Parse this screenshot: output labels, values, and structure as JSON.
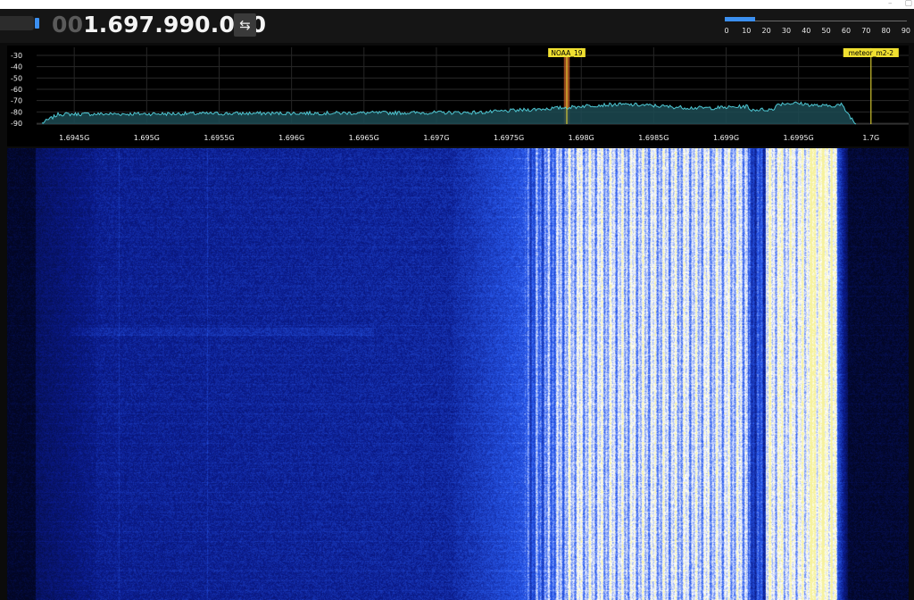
{
  "window": {
    "controls": [
      {
        "name": "minimize-button",
        "glyph": "–"
      },
      {
        "name": "maximize-button",
        "glyph": "▢"
      }
    ]
  },
  "toolbar": {
    "frequency_leading": "00",
    "frequency_main": "1.697.990.000",
    "swap_icon": "⇆"
  },
  "volume": {
    "ticks": [
      "0",
      "10",
      "20",
      "30",
      "40",
      "50",
      "60",
      "70",
      "80",
      "90"
    ],
    "tick_values": [
      0,
      10,
      20,
      30,
      40,
      50,
      60,
      70,
      80,
      90
    ],
    "value": 15,
    "max": 90,
    "color": "#3b8ff0"
  },
  "spectrum": {
    "db_labels": [
      "-30",
      "-40",
      "-50",
      "-60",
      "-70",
      "-80",
      "-90"
    ],
    "db_values": [
      -30,
      -40,
      -50,
      -60,
      -70,
      -80,
      -90
    ],
    "db_range": [
      -93,
      -25
    ],
    "freq_labels": [
      "1.6945G",
      "1.695G",
      "1.6955G",
      "1.696G",
      "1.6965G",
      "1.697G",
      "1.6975G",
      "1.698G",
      "1.6985G",
      "1.699G",
      "1.6995G",
      "1.7G"
    ],
    "freq_values": [
      1.6945,
      1.695,
      1.6955,
      1.696,
      1.6965,
      1.697,
      1.6975,
      1.698,
      1.6985,
      1.699,
      1.6995,
      1.7
    ],
    "freq_range_ghz": [
      1.69424,
      1.70026
    ],
    "bookmarks": [
      {
        "label": "NOAA_19",
        "freq_ghz": 1.6979,
        "color": "#f0e030",
        "band_color": "#c8602a",
        "band_width_ghz": 4e-05
      },
      {
        "label": "meteor_m2-2",
        "freq_ghz": 1.7,
        "color": "#f0e030"
      }
    ],
    "trace_color": "#4fc8d4",
    "fill_color": "#1c4a52"
  },
  "waterfall": {
    "colors": {
      "background": "#020624",
      "low": "#0a1a8a",
      "mid": "#2a5cf0",
      "high": "#ffffff",
      "peak": "#f6f29a"
    }
  }
}
